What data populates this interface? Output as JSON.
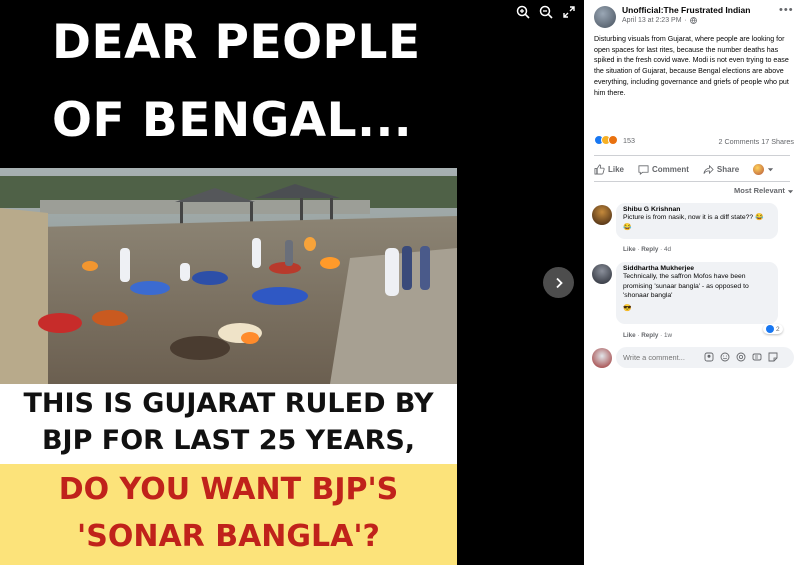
{
  "meme": {
    "headline_line1": "DEAR PEOPLE",
    "headline_line2": "OF BENGAL...",
    "middle_line1": "THIS IS GUJARAT RULED BY",
    "middle_line2": "BJP FOR LAST 25 YEARS,",
    "bottom_line1": "DO YOU WANT BJP'S",
    "bottom_line2": "'SONAR BANGLA'?"
  },
  "post": {
    "page_name": "Unofficial:The Frustrated Indian",
    "date": "April 13 at 2:23 PM",
    "audience_icon": "globe-icon",
    "text": "Disturbing visuals from Gujarat, where people are looking for open spaces for last rites, because the number deaths has spiked in the fresh covid wave. Modi is not even trying to ease the situation of Gujarat, because Bengal elections are above everything, including governance and griefs of people who put him there.",
    "reaction_count": "153",
    "comments_count": "2 Comments",
    "shares_count": "17 Shares"
  },
  "actions": {
    "like": "Like",
    "comment": "Comment",
    "share": "Share"
  },
  "sort_label": "Most Relevant",
  "comments": [
    {
      "name": "Shibu G Krishnan",
      "text": "Picture is from nasik, now it is a diff state?? 😂😂",
      "like": "Like",
      "reply": "Reply",
      "time": "4d"
    },
    {
      "name": "Siddhartha Mukherjee",
      "text": "Technically, the saffron Mofos have been promising 'sunaar bangla' - as opposed to 'shonaar bangla'",
      "emoji": "😎",
      "like": "Like",
      "reply": "Reply",
      "time": "1w",
      "reaction_count": "2"
    }
  ],
  "composer": {
    "placeholder": "Write a comment..."
  },
  "colors": {
    "facebook_blue": "#1877f2",
    "meme_red": "#c0221b",
    "meme_yellow": "#fce37a"
  }
}
